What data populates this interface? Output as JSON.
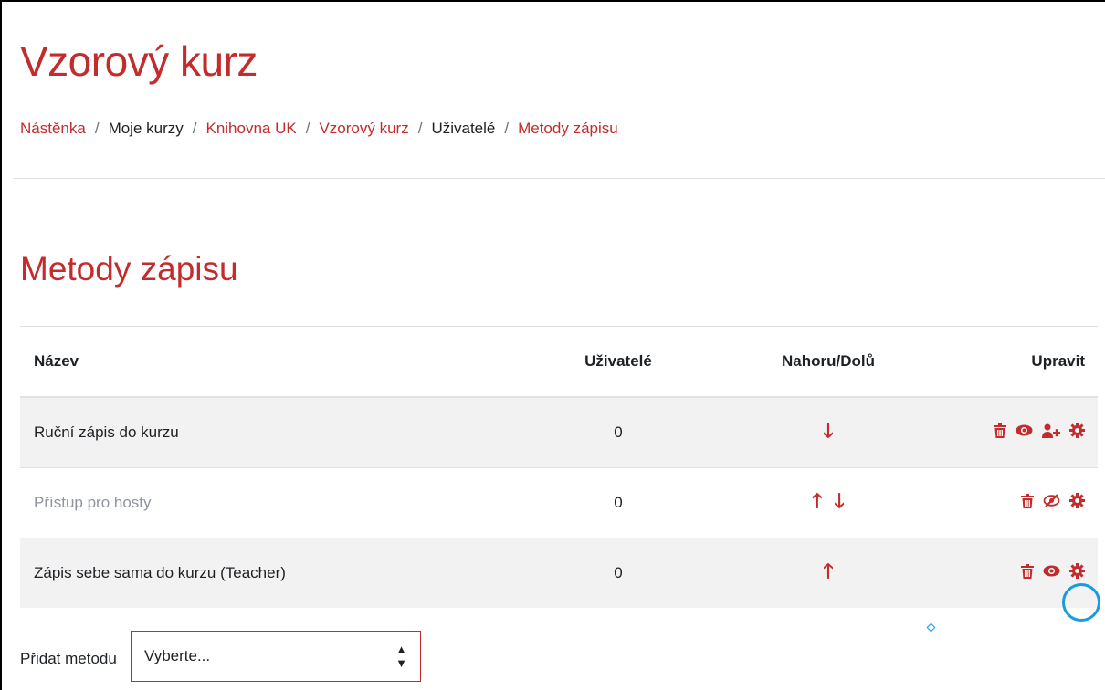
{
  "header": {
    "course_title": "Vzorový kurz",
    "breadcrumb": [
      {
        "label": "Nástěnka",
        "link": true
      },
      {
        "label": "Moje kurzy",
        "link": false
      },
      {
        "label": "Knihovna UK",
        "link": true
      },
      {
        "label": "Vzorový kurz",
        "link": true
      },
      {
        "label": "Uživatelé",
        "link": false
      },
      {
        "label": "Metody zápisu",
        "link": true
      }
    ]
  },
  "main": {
    "title": "Metody zápisu",
    "table": {
      "headers": {
        "name": "Název",
        "users": "Uživatelé",
        "updown": "Nahoru/Dolů",
        "edit": "Upravit"
      },
      "rows": [
        {
          "name": "Ruční zápis do kurzu",
          "users": "0",
          "arrows": [
            "down"
          ],
          "icons": [
            "trash-icon",
            "eye-icon",
            "enrol-users-icon",
            "gear-icon"
          ],
          "disabled": false
        },
        {
          "name": "Přístup pro hosty",
          "users": "0",
          "arrows": [
            "up",
            "down"
          ],
          "icons": [
            "trash-icon",
            "eye-slash-icon",
            "gear-icon"
          ],
          "disabled": true
        },
        {
          "name": "Zápis sebe sama do kurzu (Teacher)",
          "users": "0",
          "arrows": [
            "up"
          ],
          "icons": [
            "trash-icon",
            "eye-icon",
            "gear-icon"
          ],
          "disabled": false
        }
      ]
    },
    "add_method": {
      "label": "Přidat metodu",
      "select_value": "Vyberte..."
    }
  },
  "colors": {
    "accent": "#c22c2c",
    "highlight": "#1a9be0",
    "row_alt": "#f2f2f2"
  }
}
